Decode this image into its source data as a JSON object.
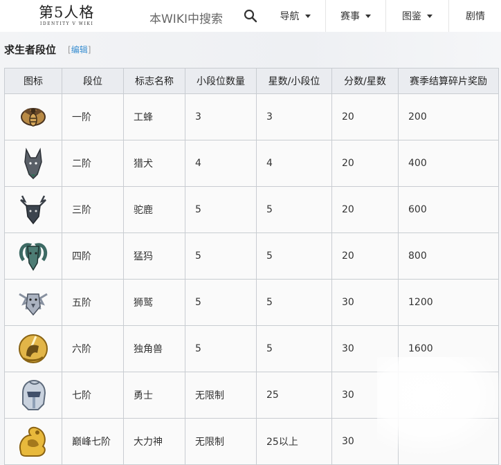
{
  "header": {
    "logo_text": "第5人格",
    "logo_sub": "IDENTITY V WIKI",
    "search_placeholder": "本WIKI中搜索",
    "nav": [
      {
        "label": "导航"
      },
      {
        "label": "赛事"
      },
      {
        "label": "图鉴"
      },
      {
        "label": "剧情"
      }
    ]
  },
  "section": {
    "title": "求生者段位",
    "edit_open": "[",
    "edit_label": "编辑",
    "edit_close": "]"
  },
  "table": {
    "headers": [
      "图标",
      "段位",
      "标志名称",
      "小段位数量",
      "星数/小段位",
      "分数/星数",
      "赛季结算碎片奖励"
    ],
    "rows": [
      {
        "icon": "worker-bee-icon",
        "tier": "一阶",
        "emblem": "工蜂",
        "sub_count": "3",
        "stars": "3",
        "points": "20",
        "reward": "200"
      },
      {
        "icon": "hound-icon",
        "tier": "二阶",
        "emblem": "猎犬",
        "sub_count": "4",
        "stars": "4",
        "points": "20",
        "reward": "400"
      },
      {
        "icon": "elk-icon",
        "tier": "三阶",
        "emblem": "驼鹿",
        "sub_count": "5",
        "stars": "5",
        "points": "20",
        "reward": "600"
      },
      {
        "icon": "mammoth-icon",
        "tier": "四阶",
        "emblem": "猛犸",
        "sub_count": "5",
        "stars": "5",
        "points": "20",
        "reward": "800"
      },
      {
        "icon": "griffin-icon",
        "tier": "五阶",
        "emblem": "狮鹫",
        "sub_count": "5",
        "stars": "5",
        "points": "30",
        "reward": "1200"
      },
      {
        "icon": "unicorn-icon",
        "tier": "六阶",
        "emblem": "独角兽",
        "sub_count": "5",
        "stars": "5",
        "points": "30",
        "reward": "1600"
      },
      {
        "icon": "warrior-helmet-icon",
        "tier": "七阶",
        "emblem": "勇士",
        "sub_count": "无限制",
        "stars": "25",
        "points": "30",
        "reward": ""
      },
      {
        "icon": "hercules-icon",
        "tier": "巅峰七阶",
        "emblem": "大力神",
        "sub_count": "无限制",
        "stars": "25以上",
        "points": "30",
        "reward": ""
      }
    ]
  }
}
